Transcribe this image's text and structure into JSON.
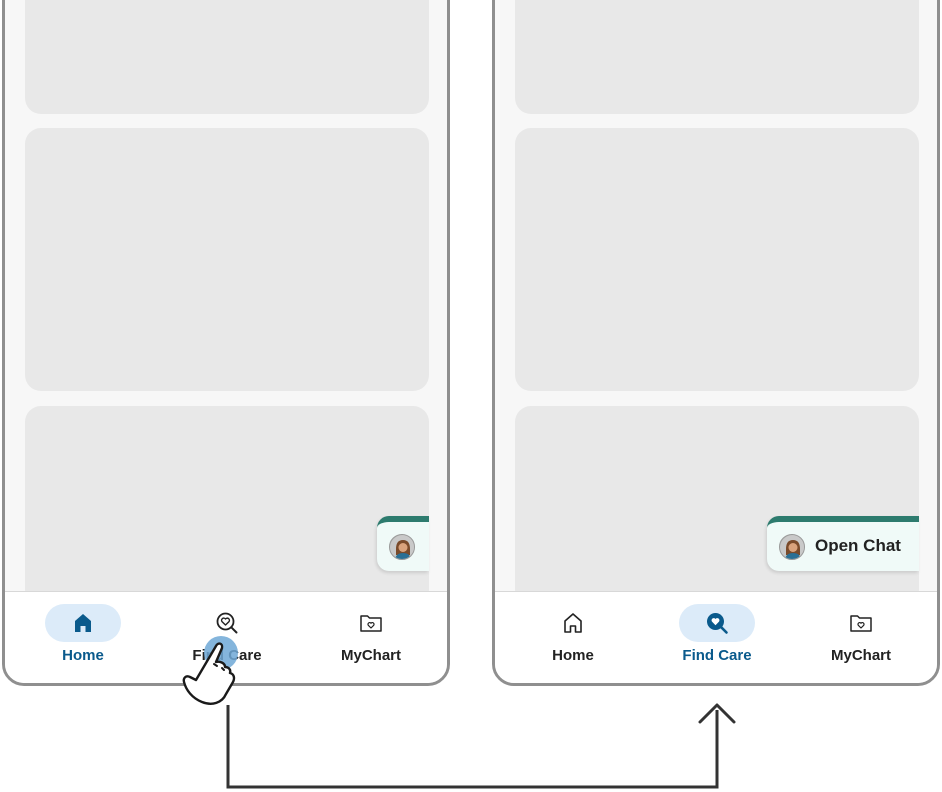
{
  "colors": {
    "accent": "#0a5a8c",
    "active_pill": "#dcebf9",
    "chat_top_bar": "#2d7b6e",
    "card_placeholder": "#e8e8e8",
    "tap_indicator": "#6fa8d6"
  },
  "screen_before": {
    "nav": [
      {
        "label": "Home",
        "icon": "home-icon",
        "active": true
      },
      {
        "label": "Find Care",
        "icon": "find-care-icon",
        "active": false
      },
      {
        "label": "MyChart",
        "icon": "mychart-folder-icon",
        "active": false
      }
    ],
    "chat_fab": {
      "icon": "agent-avatar-icon",
      "expanded": false
    }
  },
  "screen_after": {
    "nav": [
      {
        "label": "Home",
        "icon": "home-icon",
        "active": false
      },
      {
        "label": "Find Care",
        "icon": "find-care-icon",
        "active": true
      },
      {
        "label": "MyChart",
        "icon": "mychart-folder-icon",
        "active": false
      }
    ],
    "chat_fab": {
      "icon": "agent-avatar-icon",
      "label": "Open Chat",
      "expanded": true
    }
  },
  "annotation": {
    "gesture_icon": "tap-hand-icon",
    "connector": "arrow-up-icon"
  }
}
